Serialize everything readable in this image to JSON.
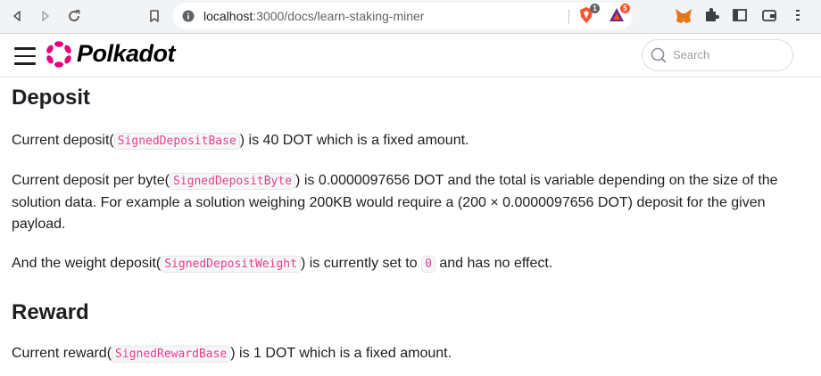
{
  "browser": {
    "url_host": "localhost",
    "url_path": ":3000/docs/learn-staking-miner",
    "brave_badge": "1",
    "bat_badge": "5"
  },
  "header": {
    "logo_text": "Polkadot",
    "search_placeholder": "Search"
  },
  "sections": {
    "deposit": {
      "heading": "Deposit",
      "p1": {
        "before": "Current deposit(",
        "code": "SignedDepositBase",
        "after": ") is 40 DOT which is a fixed amount."
      },
      "p2": {
        "before": "Current deposit per byte(",
        "code": "SignedDepositByte",
        "after": ") is 0.0000097656 DOT and the total is variable depending on the size of the solution data. For example a solution weighing 200KB would require a (200 × 0.0000097656 DOT) deposit for the given payload."
      },
      "p3": {
        "before": "And the weight deposit(",
        "code": "SignedDepositWeight",
        "middle": ") is currently set to ",
        "code2": "0",
        "after": " and has no effect."
      }
    },
    "reward": {
      "heading": "Reward",
      "p1": {
        "before": "Current reward(",
        "code": "SignedRewardBase",
        "after": ") is 1 DOT which is a fixed amount."
      }
    }
  },
  "colors": {
    "brand": "#e6007a",
    "code_text": "#e83e8c"
  }
}
